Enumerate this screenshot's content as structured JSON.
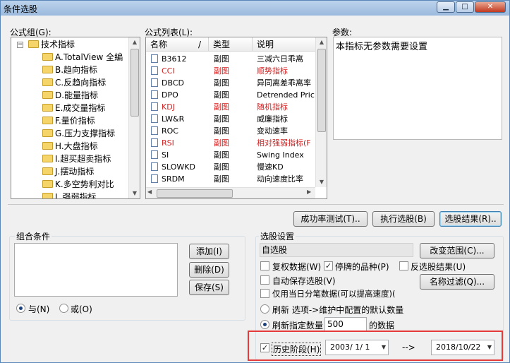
{
  "window": {
    "title": "条件选股",
    "min": "▁",
    "max": "□",
    "close": "✕"
  },
  "formula_group": {
    "label": "公式组(G):",
    "root": "技术指标",
    "items": [
      "A.TotalView 全編",
      "B.趋向指标",
      "C.反趋向指标",
      "D.能量指标",
      "E.成交量指标",
      "F.量价指标",
      "G.压力支撑指标",
      "H.大盘指标",
      "I.超买超卖指标",
      "J.摆动指标",
      "K.多空势利对比",
      "L.强弱指标"
    ]
  },
  "formula_list": {
    "label": "公式列表(L):",
    "columns": [
      "名称",
      "/",
      "类型",
      "说明"
    ],
    "rows": [
      {
        "name": "B3612",
        "type": "副图",
        "desc": "三减六日乖离",
        "red": false
      },
      {
        "name": "CCI",
        "type": "副图",
        "desc": "顺势指标",
        "red": true
      },
      {
        "name": "DBCD",
        "type": "副图",
        "desc": "异同离差乖离率",
        "red": false
      },
      {
        "name": "DPO",
        "type": "副图",
        "desc": "Detrended Pric",
        "red": false
      },
      {
        "name": "KDJ",
        "type": "副图",
        "desc": "随机指标",
        "red": true
      },
      {
        "name": "LW&R",
        "type": "副图",
        "desc": "威廉指标",
        "red": false
      },
      {
        "name": "ROC",
        "type": "副图",
        "desc": "变动速率",
        "red": false
      },
      {
        "name": "RSI",
        "type": "副图",
        "desc": "相对强弱指标(F",
        "red": true
      },
      {
        "name": "SI",
        "type": "副图",
        "desc": "Swing Index",
        "red": false
      },
      {
        "name": "SLOWKD",
        "type": "副图",
        "desc": "慢速KD",
        "red": false
      },
      {
        "name": "SRDM",
        "type": "副图",
        "desc": "动向速度比率",
        "red": false
      }
    ]
  },
  "params": {
    "label": "参数:",
    "text": "本指标无参数需要设置"
  },
  "buttons": {
    "success_test": "成功率测试(T)..",
    "run": "执行选股(B)",
    "results": "选股结果(R).."
  },
  "combo_conditions": {
    "label": "组合条件",
    "add": "添加(I)",
    "delete": "删除(D)",
    "save": "保存(S)",
    "and": "与(N)",
    "or": "或(O)"
  },
  "selection": {
    "label": "选股设置",
    "target": "自选股",
    "change_range": "改变范围(C)...",
    "restore_data": "复权数据(W)",
    "suspended": "停牌的品种(P)",
    "deselect": "反选股结果(U)",
    "auto_save": "自动保存选股(V)",
    "name_filter": "名称过滤(Q)...",
    "last_day_only": "仅用当日分笔数据(可以提高速度)(",
    "refresh_default": "刷新 选项->维护中配置的默认数量",
    "refresh_specified": "刷新指定数量",
    "refresh_count": "500",
    "refresh_unit": "的数据",
    "history": "历史阶段(H)",
    "date_from": "2003/ 1/ 1",
    "arrow": "-->",
    "date_to": "2018/10/22"
  },
  "colors": {
    "highlight_box": "#e53a3a",
    "red_text": "#d41d1d"
  }
}
